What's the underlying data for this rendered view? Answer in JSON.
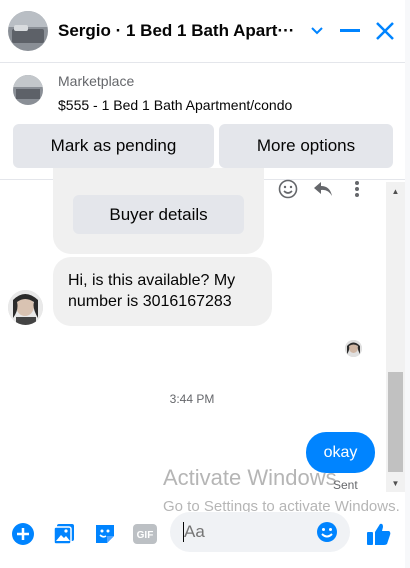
{
  "header": {
    "title": "Sergio · 1 Bed 1 Bath Apart···"
  },
  "marketplace": {
    "label": "Marketplace",
    "listing": "$555 - 1 Bed 1 Bath Apartment/condo",
    "mark_pending": "Mark as pending",
    "more_options": "More options"
  },
  "messages": {
    "buyer_details": "Buyer details",
    "incoming_text": "Hi, is this available? My number is 3016167283",
    "timestamp": "3:44 PM",
    "outgoing_text": "okay",
    "status": "Sent"
  },
  "watermark": {
    "line1": "Activate Windows",
    "line2": "Go to Settings to activate Windows."
  },
  "composer": {
    "placeholder": "Aa"
  },
  "colors": {
    "accent": "#0084ff",
    "bubble_gray": "#f0f0f0",
    "button_gray": "#e4e6eb"
  },
  "icons": [
    "avatar",
    "chevron-down-icon",
    "minimize-icon",
    "close-icon",
    "emoji-icon",
    "reply-icon",
    "more-icon",
    "plus-icon",
    "image-icon",
    "sticker-icon",
    "gif-icon",
    "like-icon"
  ]
}
